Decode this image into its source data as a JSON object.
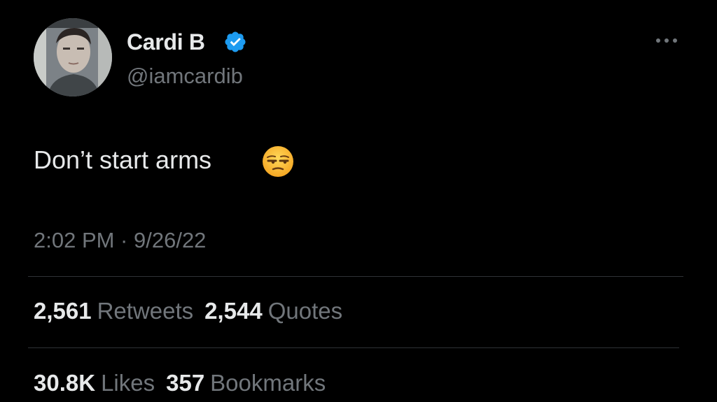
{
  "user": {
    "display_name": "Cardi B",
    "handle": "@iamcardib",
    "verified_color": "#1d9bf0"
  },
  "more_icon": "more-horizontal-icon",
  "tweet": {
    "text": "Don’t start arms",
    "emoji": "unamused-face-emoji",
    "timestamp": "2:02 PM · 9/26/22"
  },
  "stats": {
    "retweets": {
      "count": "2,561",
      "label": "Retweets"
    },
    "quotes": {
      "count": "2,544",
      "label": "Quotes"
    },
    "likes": {
      "count": "30.8K",
      "label": "Likes"
    },
    "bookmarks": {
      "count": "357",
      "label": "Bookmarks"
    }
  },
  "colors": {
    "background": "#000000",
    "primary_text": "#e7e9ea",
    "secondary_text": "#71767b",
    "divider": "#2f3336"
  }
}
